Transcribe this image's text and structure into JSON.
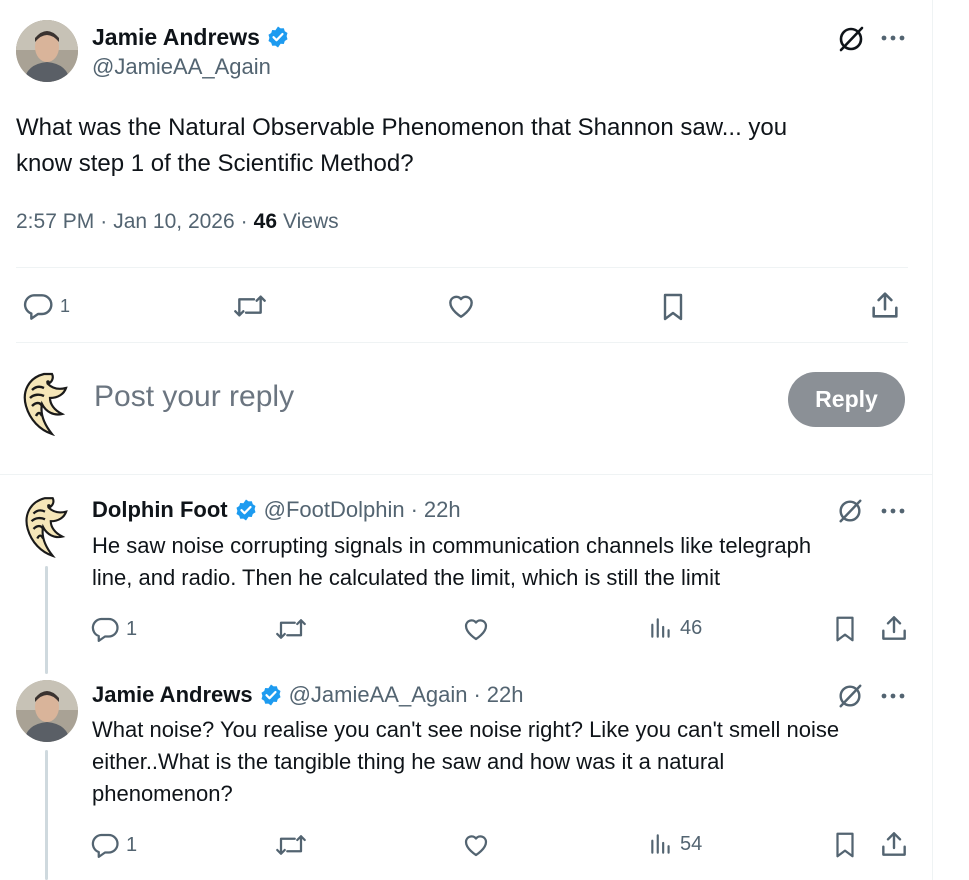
{
  "main_post": {
    "author_name": "Jamie Andrews",
    "author_handle": "@JamieAA_Again",
    "text_line1": "What was the Natural Observable Phenomenon that Shannon saw... you",
    "text_line2": "know step 1 of the Scientific Method?",
    "time": "2:57 PM",
    "date": "Jan 10, 2026",
    "views_count": "46",
    "views_label": "Views",
    "reply_count": "1"
  },
  "composer": {
    "placeholder": "Post your reply",
    "button_label": "Reply"
  },
  "replies": [
    {
      "author_name": "Dolphin Foot",
      "author_handle": "@FootDolphin",
      "age": "22h",
      "text_line1": "He saw noise corrupting signals in communication channels like  telegraph",
      "text_line2": "line, and radio.  Then he calculated the limit, which is still the limit",
      "reply_count": "1",
      "views": "46"
    },
    {
      "author_name": "Jamie Andrews",
      "author_handle": "@JamieAA_Again",
      "age": "22h",
      "text_line1": "What noise? You realise you can't see noise right? Like you can't smell noise",
      "text_line2": "either..What is the tangible thing he saw and how was it a natural",
      "text_line3": "phenomenon?",
      "reply_count": "1",
      "views": "54"
    }
  ],
  "separators": {
    "dot": "·"
  },
  "colors": {
    "verified": "#1d9bf0",
    "muted": "#536471",
    "reply_button": "#8b9096"
  }
}
